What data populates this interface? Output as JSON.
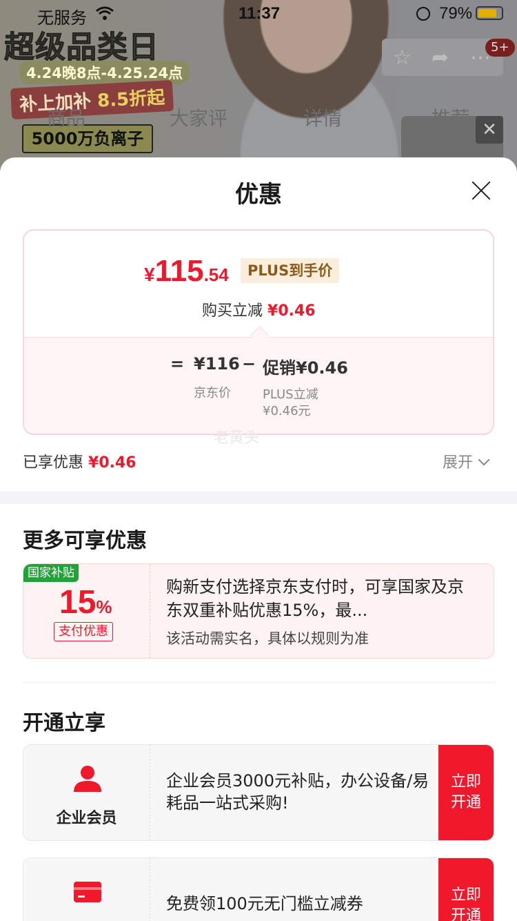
{
  "status_bar": {
    "carrier": "无服务",
    "time": "11:37",
    "battery": "79%"
  },
  "background": {
    "promo_title": "超级品类日",
    "promo_date": "4.24晚8点-4.25.24点",
    "promo_sub_prefix": "补上加补",
    "promo_sub_discount": "8.5折起",
    "promo_box": "5000万负离子",
    "tabs": [
      "商品",
      "大家评",
      "详情",
      "推荐"
    ],
    "cart_badge": "5+"
  },
  "sheet": {
    "title": "优惠",
    "price": {
      "currency": "¥",
      "integer": "115",
      "decimal": ".54",
      "plus_tag": "PLUS到手价",
      "buy_label": "购买立减",
      "buy_amount": "¥0.46"
    },
    "calc": {
      "equals": "=",
      "jd_price": "¥116",
      "jd_price_label": "京东价",
      "minus": "−",
      "promo": "促销¥0.46",
      "promo_sub1": "PLUS立减",
      "promo_sub2": "¥0.46元"
    },
    "watermark": "老黄头",
    "enjoyed_label": "已享优惠",
    "enjoyed_amount": "¥0.46",
    "expand_label": "展开",
    "more_title": "更多可享优惠",
    "coupon": {
      "tag": "国家补贴",
      "percent": "15",
      "unit": "%",
      "pay_tag": "支付优惠",
      "desc": "购新支付选择京东支付时，可享国家及京东双重补贴优惠15%，最...",
      "note": "该活动需实名，具体以规则为准"
    },
    "open_title": "开通立享",
    "open_items": [
      {
        "icon": "person-icon",
        "label": "企业会员",
        "desc": "企业会员3000元补贴，办公设备/易耗品一站式采购!",
        "btn_line1": "立即",
        "btn_line2": "开通"
      },
      {
        "icon": "card-icon",
        "label": "",
        "desc": "免费领100元无门槛立减券",
        "btn_line1": "立即",
        "btn_line2": "开通"
      }
    ],
    "colors": {
      "accent": "#f0192b",
      "gov_green": "#21a33a",
      "plus_gold": "#8b5a1c"
    }
  }
}
